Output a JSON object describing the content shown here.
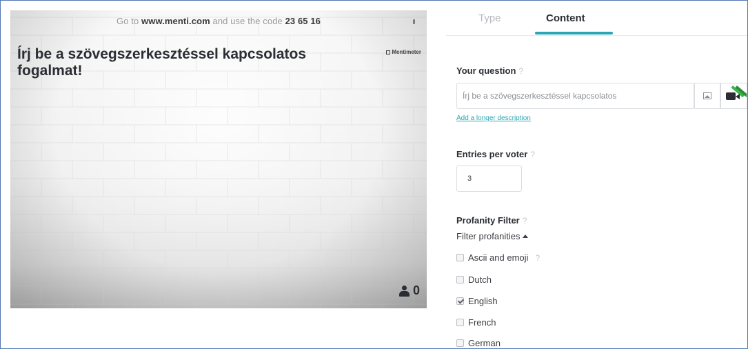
{
  "preview": {
    "join_prefix": "Go to",
    "join_url": "www.menti.com",
    "join_middle": "and use the code",
    "join_code": "23 65 16",
    "title": "Írj be a szövegszerkesztéssel kapcsolatos fogalmat!",
    "brand": "Mentimeter",
    "voter_count": "0"
  },
  "tabs": {
    "type_label": "Type",
    "content_label": "Content",
    "active": "Content"
  },
  "question": {
    "label": "Your question",
    "help": "?",
    "value": "Írj be a szövegszerkesztéssel kapcsolatos",
    "add_description": "Add a longer description"
  },
  "entries": {
    "label": "Entries per voter",
    "help": "?",
    "value": "3"
  },
  "profanity": {
    "label": "Profanity Filter",
    "help": "?",
    "toggle_label": "Filter profanities",
    "options": [
      {
        "label": "Ascii and emoji",
        "checked": false,
        "help": "?"
      },
      {
        "label": "Dutch",
        "checked": false
      },
      {
        "label": "English",
        "checked": true
      },
      {
        "label": "French",
        "checked": false
      },
      {
        "label": "German",
        "checked": false
      }
    ]
  },
  "colors": {
    "accent": "#2aa7b5",
    "text": "#2a2d33",
    "muted": "#b6b9bf"
  }
}
